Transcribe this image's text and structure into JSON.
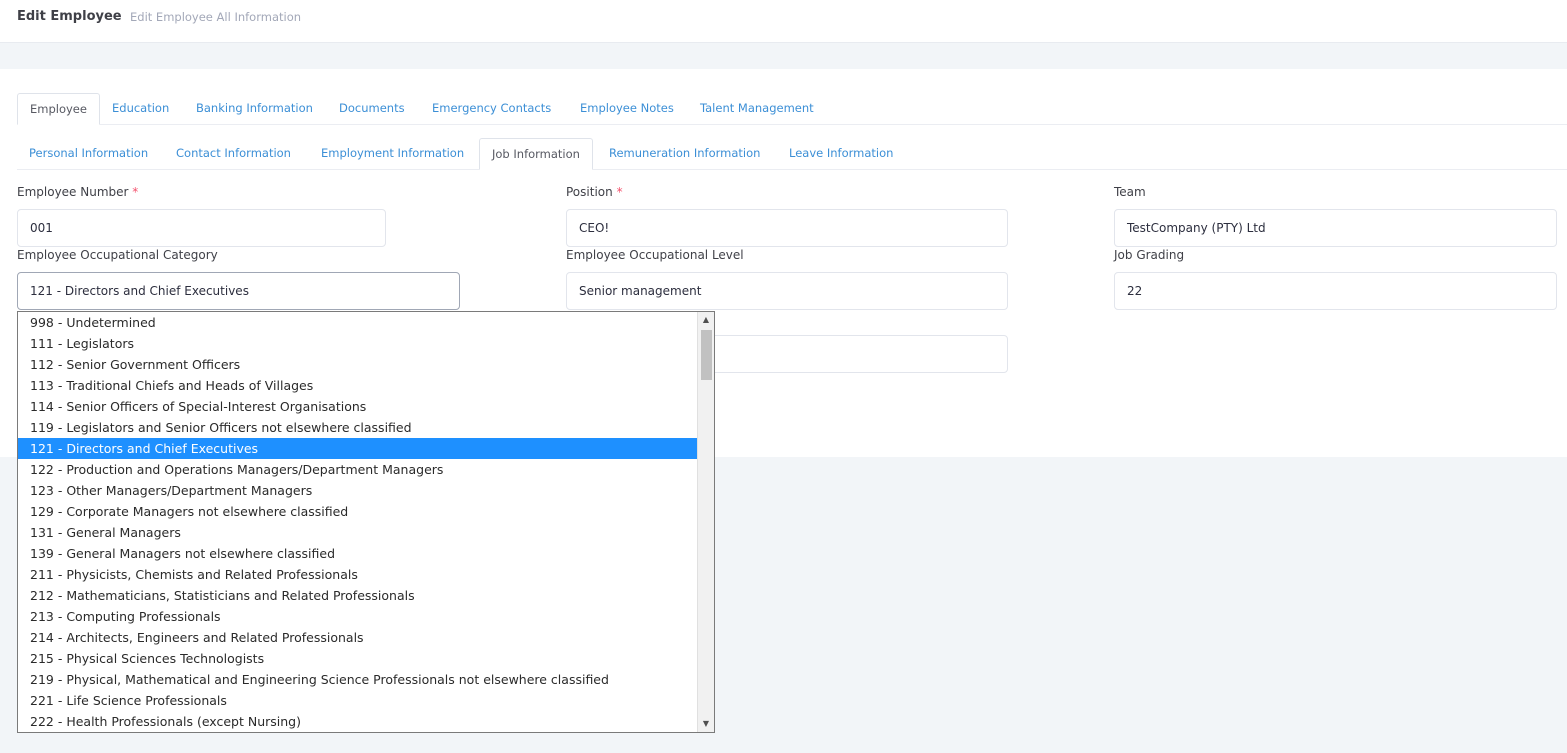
{
  "header": {
    "title": "Edit Employee",
    "subtitle": "Edit Employee All Information"
  },
  "main_tabs": [
    "Employee",
    "Education",
    "Banking Information",
    "Documents",
    "Emergency Contacts",
    "Employee Notes",
    "Talent Management"
  ],
  "sub_tabs": [
    "Personal Information",
    "Contact Information",
    "Employment Information",
    "Job Information",
    "Remuneration Information",
    "Leave Information"
  ],
  "active_main_tab": "Employee",
  "active_sub_tab": "Job Information",
  "form": {
    "employee_number": {
      "label": "Employee Number",
      "required": "*",
      "value": "001"
    },
    "position": {
      "label": "Position",
      "required": "*",
      "value": "CEO!"
    },
    "team": {
      "label": "Team",
      "value": "TestCompany (PTY) Ltd"
    },
    "occupational_category": {
      "label": "Employee Occupational Category",
      "value": "121 - Directors and Chief Executives"
    },
    "occupational_level": {
      "label": "Employee Occupational Level",
      "value": "Senior management"
    },
    "job_grading": {
      "label": "Job Grading",
      "value": "22"
    },
    "hidden_field": {
      "value": ""
    }
  },
  "dropdown": {
    "selected": "121 - Directors and Chief Executives",
    "options": [
      "998 - Undetermined",
      "111 - Legislators",
      "112 - Senior Government Officers",
      "113 - Traditional Chiefs and Heads of Villages",
      "114 - Senior Officers of Special-Interest Organisations",
      "119 - Legislators and Senior Officers not elsewhere classified",
      "121 - Directors and Chief Executives",
      "122 - Production and Operations Managers/Department Managers",
      "123 - Other Managers/Department Managers",
      "129 - Corporate Managers not elsewhere classified",
      "131 - General Managers",
      "139 - General Managers not elsewhere classified",
      "211 - Physicists, Chemists and Related Professionals",
      "212 - Mathematicians, Statisticians and Related Professionals",
      "213 - Computing Professionals",
      "214 - Architects, Engineers and Related Professionals",
      "215 - Physical Sciences Technologists",
      "219 - Physical, Mathematical and Engineering Science Professionals not elsewhere classified",
      "221 - Life Science Professionals",
      "222 - Health Professionals (except Nursing)"
    ]
  },
  "icons": {
    "scroll_up": "▲",
    "scroll_down": "▼"
  },
  "colors": {
    "link": "#3c8fd6",
    "selected": "#1e90ff",
    "required": "#f4516c"
  }
}
